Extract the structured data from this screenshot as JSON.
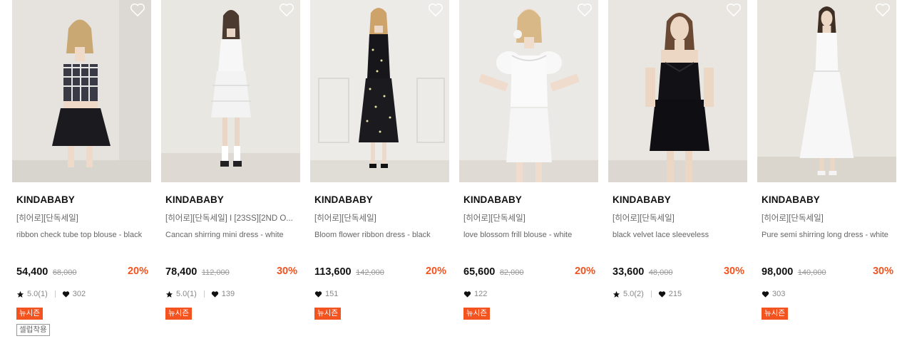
{
  "colors": {
    "accent": "#f2531f",
    "text": "#111111",
    "muted": "#666666"
  },
  "products": [
    {
      "brand": "KINDABABY",
      "tags": "[히어로][단독세일]",
      "title": "ribbon check tube top blouse - black",
      "price": "54,400",
      "original_price": "68,000",
      "discount": "20%",
      "rating": "5.0(1)",
      "likes": "302",
      "badges": [
        "뉴시즌",
        "셀럽착용"
      ],
      "wishlist_icon": "heart-outline-icon"
    },
    {
      "brand": "KINDABABY",
      "tags": "[히어로][단독세일] I [23SS][2ND O...",
      "title": "Cancan shirring mini dress - white",
      "price": "78,400",
      "original_price": "112,000",
      "discount": "30%",
      "rating": "5.0(1)",
      "likes": "139",
      "badges": [
        "뉴시즌"
      ],
      "wishlist_icon": "heart-outline-icon"
    },
    {
      "brand": "KINDABABY",
      "tags": "[히어로][단독세일]",
      "title": "Bloom flower ribbon dress - black",
      "price": "113,600",
      "original_price": "142,000",
      "discount": "20%",
      "rating": "",
      "likes": "151",
      "badges": [
        "뉴시즌"
      ],
      "wishlist_icon": "heart-outline-icon"
    },
    {
      "brand": "KINDABABY",
      "tags": "[히어로][단독세일]",
      "title": "love blossom frill blouse - white",
      "price": "65,600",
      "original_price": "82,000",
      "discount": "20%",
      "rating": "",
      "likes": "122",
      "badges": [
        "뉴시즌"
      ],
      "wishlist_icon": "heart-outline-icon"
    },
    {
      "brand": "KINDABABY",
      "tags": "[히어로][단독세일]",
      "title": "black velvet lace sleeveless",
      "price": "33,600",
      "original_price": "48,000",
      "discount": "30%",
      "rating": "5.0(2)",
      "likes": "215",
      "badges": [],
      "wishlist_icon": "heart-outline-icon"
    },
    {
      "brand": "KINDABABY",
      "tags": "[히어로][단독세일]",
      "title": "Pure semi shirring long dress - white",
      "price": "98,000",
      "original_price": "140,000",
      "discount": "30%",
      "rating": "",
      "likes": "303",
      "badges": [
        "뉴시즌"
      ],
      "wishlist_icon": "heart-outline-icon"
    }
  ]
}
